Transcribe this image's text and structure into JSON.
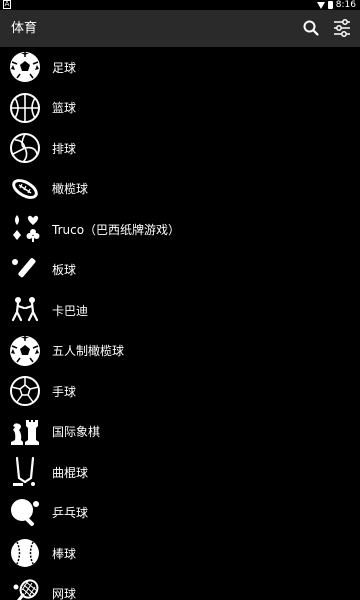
{
  "status_bar": {
    "time": "8:16",
    "left_indicator": "A"
  },
  "header": {
    "title": "体育",
    "search_icon": "search-icon",
    "filter_icon": "sliders-icon"
  },
  "colors": {
    "background": "#000000",
    "header": "#2a2a2a",
    "text": "#ffffff"
  },
  "sports": [
    {
      "label": "足球",
      "icon": "soccer-ball-icon"
    },
    {
      "label": "篮球",
      "icon": "basketball-icon"
    },
    {
      "label": "排球",
      "icon": "volleyball-icon"
    },
    {
      "label": "橄榄球",
      "icon": "football-icon"
    },
    {
      "label": "Truco（巴西纸牌游戏）",
      "icon": "card-suits-icon"
    },
    {
      "label": "板球",
      "icon": "cricket-icon"
    },
    {
      "label": "卡巴迪",
      "icon": "kabaddi-icon"
    },
    {
      "label": "五人制橄榄球",
      "icon": "futsal-ball-icon"
    },
    {
      "label": "手球",
      "icon": "handball-icon"
    },
    {
      "label": "国际象棋",
      "icon": "chess-icon"
    },
    {
      "label": "曲棍球",
      "icon": "hockey-icon"
    },
    {
      "label": "乒乓球",
      "icon": "table-tennis-icon"
    },
    {
      "label": "棒球",
      "icon": "baseball-icon"
    },
    {
      "label": "网球",
      "icon": "tennis-icon"
    }
  ]
}
